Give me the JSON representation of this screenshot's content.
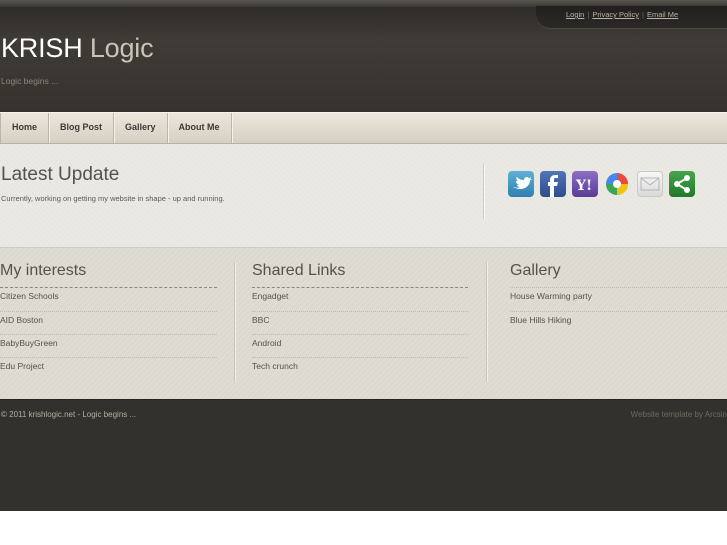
{
  "top_links": {
    "login": "Login",
    "privacy": "Privacy Policy",
    "email": "Email Me",
    "separator": "|"
  },
  "site": {
    "title_part1": "KRISH",
    "title_part2": "Logic",
    "tagline": "Logic begins ..."
  },
  "nav": {
    "items": [
      "Home",
      "Blog Post",
      "Gallery",
      "About Me"
    ]
  },
  "feature": {
    "title": "Latest Update",
    "text": "Currently, working on getting my website in shape - up and running.",
    "share_icons": [
      "twitter-icon",
      "facebook-icon",
      "yahoo-icon",
      "google-icon",
      "email-icon",
      "share-icon"
    ]
  },
  "columns": {
    "interests": {
      "title": "My interests",
      "items": [
        "Citizen Schools",
        "AID Boston",
        "BabyBuyGreen",
        "Edu Project"
      ]
    },
    "links": {
      "title": "Shared Links",
      "items": [
        "Engadget",
        "BBC",
        "Android",
        "Tech crunch"
      ]
    },
    "gallery": {
      "title": "Gallery",
      "items": [
        "House Warming party",
        "Blue Hills Hiking"
      ]
    }
  },
  "footer": {
    "copyright": "© 2011 krishlogic.net - Logic begins ...",
    "credit": "Website template by Arcsin"
  },
  "colors": {
    "header_bg": "#3a3733",
    "nav_bg": "#e2dbd0",
    "content_bg": "#e8e6e0",
    "footer_bg": "#33312e"
  }
}
